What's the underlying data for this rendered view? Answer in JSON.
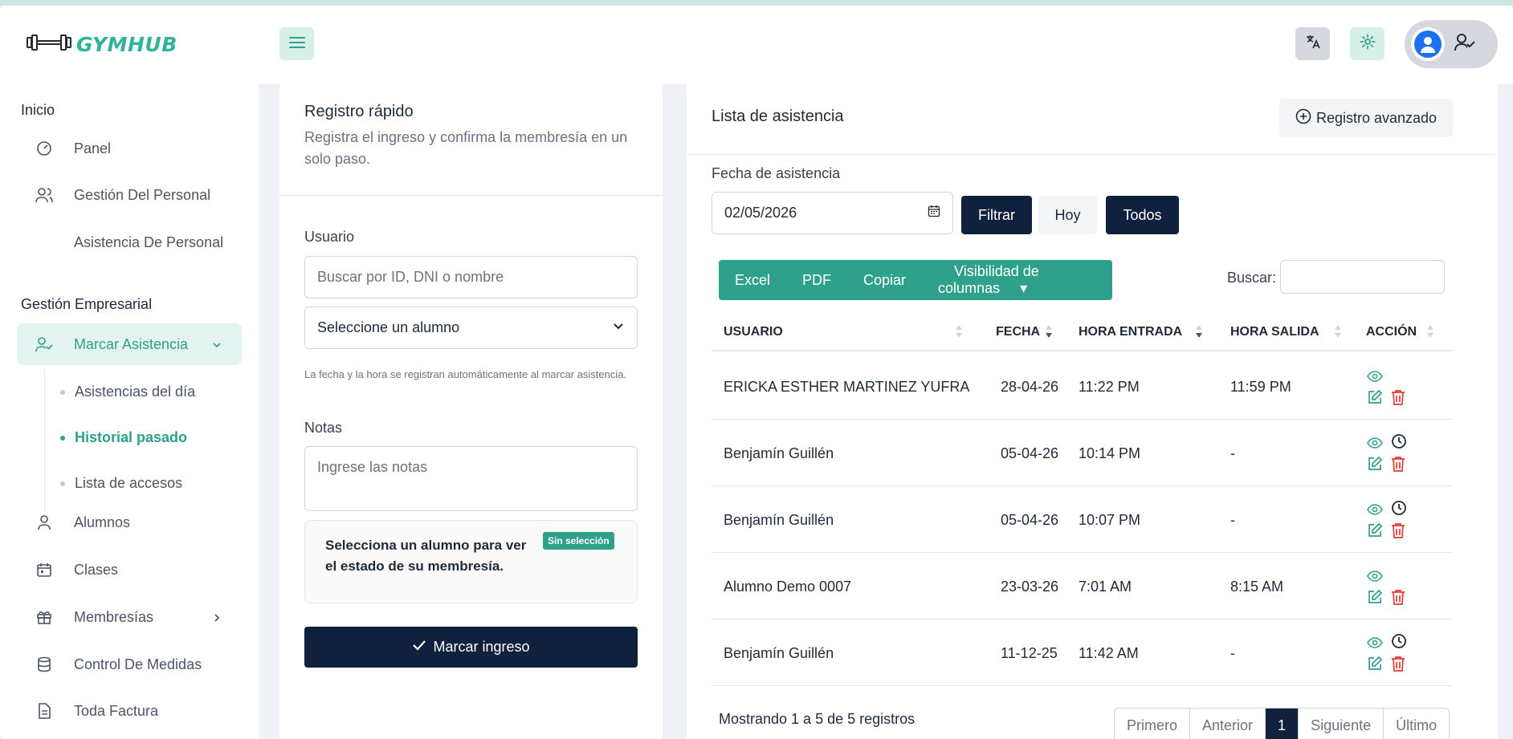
{
  "brand": {
    "name": "GYMHUB",
    "accent": "#2fb39a"
  },
  "header": {
    "menu_icon": "hamburger-icon",
    "translate_icon": "translate-icon",
    "settings_icon": "gear-icon",
    "user_icon": "user-check-icon"
  },
  "sidebar": {
    "sections": [
      {
        "title": "Inicio"
      },
      {
        "title": "Gestión Empresarial"
      }
    ],
    "items": [
      {
        "label": "Panel",
        "icon": "dashboard-icon"
      },
      {
        "label": "Gestión Del Personal",
        "icon": "users-icon"
      },
      {
        "label": "Asistencia De Personal",
        "icon": ""
      },
      {
        "label": "Marcar Asistencia",
        "icon": "user-check-icon",
        "active": true
      },
      {
        "label": "Alumnos",
        "icon": "user-icon"
      },
      {
        "label": "Clases",
        "icon": "calendar-icon"
      },
      {
        "label": "Membresías",
        "icon": "gift-icon"
      },
      {
        "label": "Control De Medidas",
        "icon": "database-icon"
      },
      {
        "label": "Toda Factura",
        "icon": "file-icon"
      }
    ],
    "subitems": [
      {
        "label": "Asistencias del día"
      },
      {
        "label": "Historial pasado",
        "active": true
      },
      {
        "label": "Lista de accesos"
      }
    ]
  },
  "quick": {
    "title": "Registro rápido",
    "subtitle": "Registra el ingreso y confirma la membresía en un solo paso.",
    "user_label": "Usuario",
    "search_placeholder": "Buscar por ID, DNI o nombre",
    "select_value": "Seleccione un alumno",
    "hint": "La fecha y la hora se registran automáticamente al marcar asistencia.",
    "notes_label": "Notas",
    "notes_placeholder": "Ingrese las notas",
    "status_text": "Selecciona un alumno para ver el estado de su membresía.",
    "status_badge": "Sin selección",
    "submit_label": "Marcar ingreso"
  },
  "attendance": {
    "title": "Lista de asistencia",
    "advanced_label": "Registro avanzado",
    "date_label": "Fecha de asistencia",
    "date_value": "02/05/2026",
    "filter_label": "Filtrar",
    "today_label": "Hoy",
    "all_label": "Todos",
    "export": [
      "Excel",
      "PDF",
      "Copiar",
      "Visibilidad de columnas"
    ],
    "search_label": "Buscar:",
    "columns": [
      "USUARIO",
      "FECHA",
      "HORA ENTRADA",
      "HORA SALIDA",
      "ACCIÓN"
    ],
    "rows": [
      {
        "user": "ERICKA ESTHER MARTINEZ YUFRA",
        "date": "28-04-26",
        "in": "11:22 PM",
        "out": "11:59 PM",
        "clock": false
      },
      {
        "user": "Benjamín Guillén",
        "date": "05-04-26",
        "in": "10:14 PM",
        "out": "-",
        "clock": true
      },
      {
        "user": "Benjamín Guillén",
        "date": "05-04-26",
        "in": "10:07 PM",
        "out": "-",
        "clock": true
      },
      {
        "user": "Alumno Demo 0007",
        "date": "23-03-26",
        "in": "7:01 AM",
        "out": "8:15 AM",
        "clock": false
      },
      {
        "user": "Benjamín Guillén",
        "date": "11-12-25",
        "in": "11:42 AM",
        "out": "-",
        "clock": true
      }
    ],
    "info": "Mostrando 1 a 5 de 5 registros",
    "pager": [
      "Primero",
      "Anterior",
      "1",
      "Siguiente",
      "Último"
    ]
  }
}
